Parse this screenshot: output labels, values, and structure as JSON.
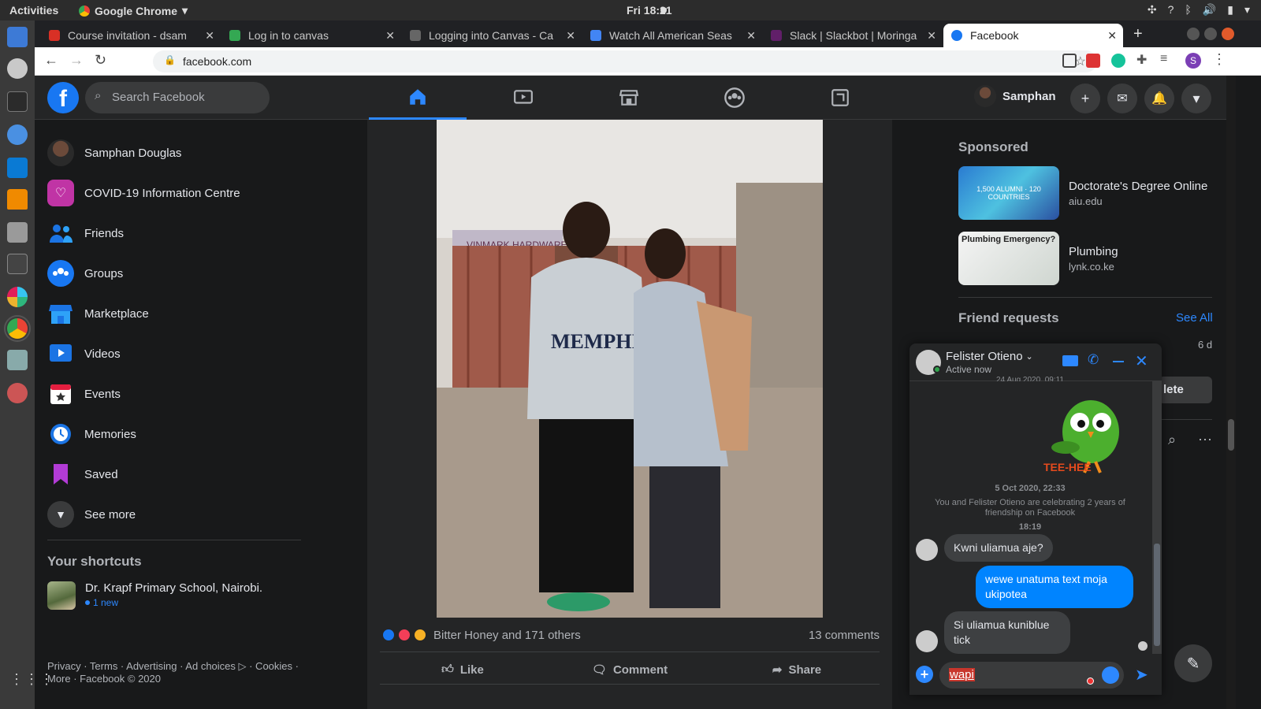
{
  "system": {
    "activities": "Activities",
    "app": "Google Chrome",
    "clock": "Fri 18:21"
  },
  "tabs": [
    {
      "label": "Course invitation - dsam",
      "favicon_color": "#d93025"
    },
    {
      "label": "Log in to canvas",
      "favicon_color": "#34a853"
    },
    {
      "label": "Logging into Canvas - Ca",
      "favicon_color": "#666666"
    },
    {
      "label": "Watch All American Seas",
      "favicon_color": "#4285f4"
    },
    {
      "label": "Slack | Slackbot | Moringa",
      "favicon_color": "#611f69"
    },
    {
      "label": "Facebook",
      "favicon_color": "#1877f2"
    }
  ],
  "address": {
    "url": "facebook.com"
  },
  "fb": {
    "search_placeholder": "Search Facebook",
    "profile_name": "Samphan",
    "nav": [
      "home-icon",
      "watch-icon",
      "marketplace-icon",
      "groups-icon",
      "gaming-icon"
    ],
    "accent": "#2d88ff"
  },
  "sidebar": {
    "items": [
      {
        "label": "Samphan Douglas",
        "icon": "avatar"
      },
      {
        "label": "COVID-19 Information Centre",
        "icon": "heart-shield-icon"
      },
      {
        "label": "Friends",
        "icon": "friends-icon"
      },
      {
        "label": "Groups",
        "icon": "groups-icon"
      },
      {
        "label": "Marketplace",
        "icon": "marketplace-icon"
      },
      {
        "label": "Videos",
        "icon": "video-icon"
      },
      {
        "label": "Events",
        "icon": "events-icon"
      },
      {
        "label": "Memories",
        "icon": "clock-icon"
      },
      {
        "label": "Saved",
        "icon": "bookmark-icon"
      },
      {
        "label": "See more",
        "icon": "chevron-down-icon"
      }
    ],
    "shortcuts_title": "Your shortcuts",
    "shortcut": {
      "label": "Dr. Krapf Primary School, Nairobi.",
      "badge": "1 new"
    },
    "footer": "Privacy · Terms · Advertising · Ad choices ▷ · Cookies · More · Facebook © 2020"
  },
  "post": {
    "reactions_text": "Bitter Honey and 171 others",
    "comments": "13 comments",
    "actions": {
      "like": "Like",
      "comment": "Comment",
      "share": "Share"
    },
    "photo_text": "MEMPHIS",
    "sign_text": "VINMARK HARDWARE"
  },
  "right": {
    "sponsored_title": "Sponsored",
    "ads": [
      {
        "title": "Doctorate's Degree Online",
        "domain": "aiu.edu",
        "image_text": "1,500 ALUMNI · 120 COUNTRIES"
      },
      {
        "title": "Plumbing",
        "domain": "lynk.co.ke",
        "image_text": "Plumbing Emergency?"
      }
    ],
    "friend_requests_title": "Friend requests",
    "see_all": "See All",
    "request_time": "6 d",
    "delete_fragment": "lete"
  },
  "chat": {
    "name": "Felister Otieno",
    "status": "Active now",
    "prev_time": "24 Aug 2020, 09:11",
    "sticker_text": "TEE-HEE",
    "date": "5 Oct 2020, 22:33",
    "system_msg": "You and Felister Otieno are celebrating 2 years of friendship on Facebook",
    "time": "18:19",
    "messages": [
      {
        "from": "them",
        "text": "Kwni uliamua aje?"
      },
      {
        "from": "me",
        "text": "wewe unatuma text moja ukipotea"
      },
      {
        "from": "them",
        "text": "Si uliamua kuniblue tick"
      }
    ],
    "input_value": "wapi",
    "me_color": "#0084ff"
  }
}
